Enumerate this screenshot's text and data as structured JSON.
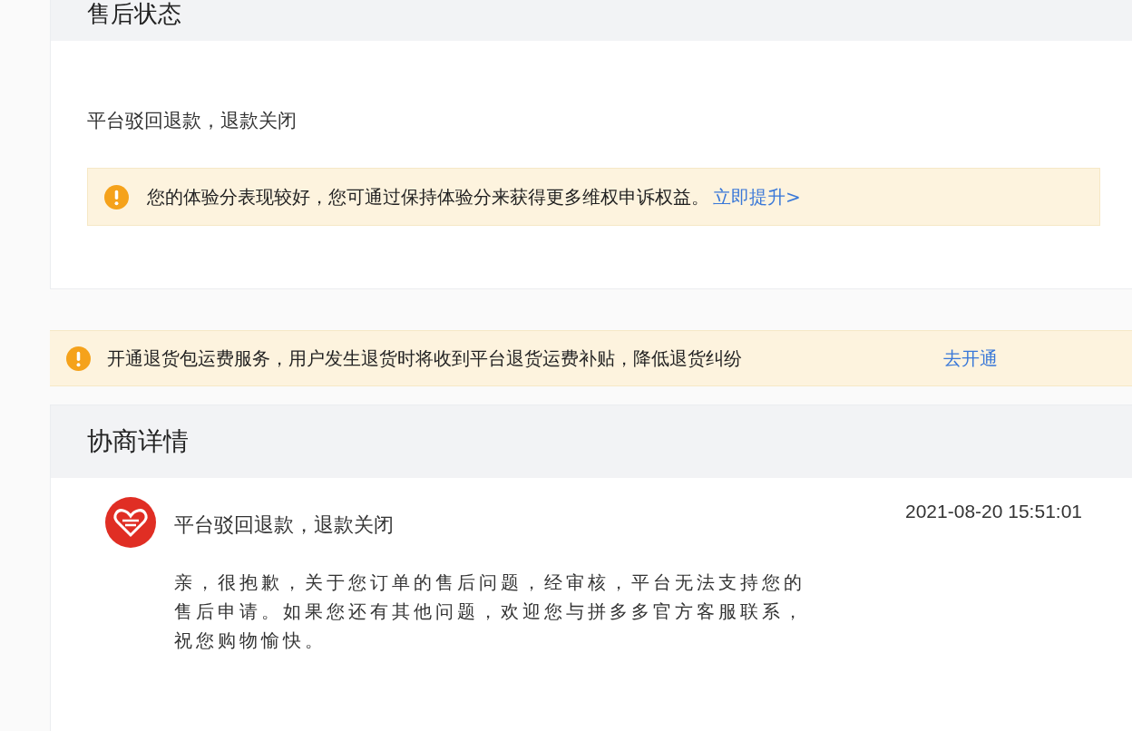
{
  "after_sales_status": {
    "title": "售后状态",
    "status": "平台驳回退款，退款关闭",
    "notice": {
      "text": "您的体验分表现较好，您可通过保持体验分来获得更多维权申诉权益。",
      "link": "立即提升>"
    }
  },
  "banner": {
    "text": "开通退货包运费服务，用户发生退货时将收到平台退货运费补贴，降低退货纠纷",
    "link": "去开通"
  },
  "negotiation": {
    "title": "协商详情",
    "entries": [
      {
        "title": "平台驳回退款，退款关闭",
        "time": "2021-08-20 15:51:01",
        "message": "亲，很抱歉，关于您订单的售后问题，经审核，平台无法支持您的售后申请。如果您还有其他问题，欢迎您与拼多多官方客服联系，祝您购物愉快。"
      }
    ]
  }
}
